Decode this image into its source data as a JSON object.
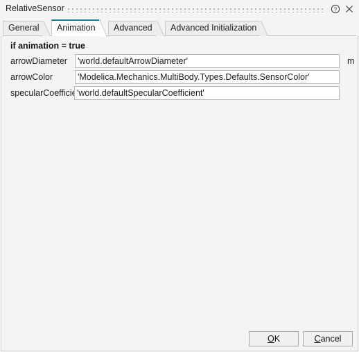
{
  "window": {
    "title": "RelativeSensor",
    "titlebar_icons": [
      {
        "name": "help-icon",
        "glyph": "?"
      },
      {
        "name": "close-icon",
        "glyph": "×"
      }
    ]
  },
  "tabs": [
    {
      "label": "General",
      "active": false
    },
    {
      "label": "Animation",
      "active": true
    },
    {
      "label": "Advanced",
      "active": false
    },
    {
      "label": "Advanced Initialization",
      "active": false
    }
  ],
  "form": {
    "group_heading": "if animation = true",
    "rows": [
      {
        "label": "arrowDiameter",
        "value": "'world.defaultArrowDiameter'",
        "unit": "m"
      },
      {
        "label": "arrowColor",
        "value": "'Modelica.Mechanics.MultiBody.Types.Defaults.SensorColor'",
        "unit": ""
      },
      {
        "label": "specularCoefficient",
        "value": "'world.defaultSpecularCoefficient'",
        "unit": ""
      }
    ]
  },
  "buttons": {
    "ok": {
      "prefix": "",
      "accel": "O",
      "suffix": "K"
    },
    "cancel": {
      "prefix": "",
      "accel": "C",
      "suffix": "ancel"
    }
  },
  "colors": {
    "active_tab_accent": "#1a7d9e",
    "window_bg": "#f4f4f4",
    "field_bg": "#ffffff",
    "field_border": "#b9b9b9"
  }
}
